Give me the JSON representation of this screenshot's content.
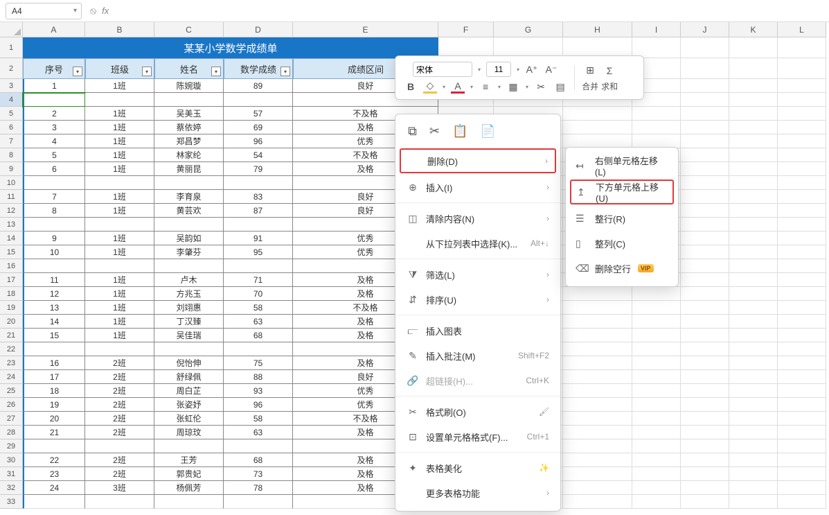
{
  "namebox": "A4",
  "fx": "fx",
  "cols": [
    "A",
    "B",
    "C",
    "D",
    "E",
    "F",
    "G",
    "H",
    "I",
    "J",
    "K",
    "L"
  ],
  "table": {
    "title": "某某小学数学成绩单",
    "headers": [
      "序号",
      "班级",
      "姓名",
      "数学成绩",
      "成绩区间"
    ]
  },
  "rows": [
    [
      "1",
      "1班",
      "陈婉璇",
      "89",
      "良好"
    ],
    [
      "",
      "",
      "",
      "",
      ""
    ],
    [
      "2",
      "1班",
      "吴美玉",
      "57",
      "不及格"
    ],
    [
      "3",
      "1班",
      "蔡依婷",
      "69",
      "及格"
    ],
    [
      "4",
      "1班",
      "郑昌梦",
      "96",
      "优秀"
    ],
    [
      "5",
      "1班",
      "林家纶",
      "54",
      "不及格"
    ],
    [
      "6",
      "1班",
      "黄丽昆",
      "79",
      "及格"
    ],
    [
      "",
      "",
      "",
      "",
      ""
    ],
    [
      "7",
      "1班",
      "李育泉",
      "83",
      "良好"
    ],
    [
      "8",
      "1班",
      "黄芸欢",
      "87",
      "良好"
    ],
    [
      "",
      "",
      "",
      "",
      ""
    ],
    [
      "9",
      "1班",
      "吴韵如",
      "91",
      "优秀"
    ],
    [
      "10",
      "1班",
      "李肇芬",
      "95",
      "优秀"
    ],
    [
      "",
      "",
      "",
      "",
      ""
    ],
    [
      "11",
      "1班",
      "卢木",
      "71",
      "及格"
    ],
    [
      "12",
      "1班",
      "方兆玉",
      "70",
      "及格"
    ],
    [
      "13",
      "1班",
      "刘翊惠",
      "58",
      "不及格"
    ],
    [
      "14",
      "1班",
      "丁汉臻",
      "63",
      "及格"
    ],
    [
      "15",
      "1班",
      "吴佳瑞",
      "68",
      "及格"
    ],
    [
      "",
      "",
      "",
      "",
      ""
    ],
    [
      "16",
      "2班",
      "倪怡伸",
      "75",
      "及格"
    ],
    [
      "17",
      "2班",
      "舒绿佩",
      "88",
      "良好"
    ],
    [
      "18",
      "2班",
      "周白芷",
      "93",
      "优秀"
    ],
    [
      "19",
      "2班",
      "张姿妤",
      "96",
      "优秀"
    ],
    [
      "20",
      "2班",
      "张虹伦",
      "58",
      "不及格"
    ],
    [
      "21",
      "2班",
      "周琼玟",
      "63",
      "及格"
    ],
    [
      "",
      "",
      "",
      "",
      ""
    ],
    [
      "22",
      "2班",
      "王芳",
      "68",
      "及格"
    ],
    [
      "23",
      "2班",
      "郭贵妃",
      "73",
      "及格"
    ],
    [
      "24",
      "3班",
      "杨佩芳",
      "78",
      "及格"
    ]
  ],
  "mini": {
    "font": "宋体",
    "size": "11",
    "merge": "合并",
    "sum": "求和"
  },
  "menu": {
    "delete": "删除(D)",
    "insert": "插入(I)",
    "clear": "清除内容(N)",
    "droplist": "从下拉列表中选择(K)...",
    "droplist_hint": "Alt+↓",
    "filter": "筛选(L)",
    "sort": "排序(U)",
    "chart": "插入图表",
    "comment": "插入批注(M)",
    "comment_hint": "Shift+F2",
    "hyperlink": "超链接(H)...",
    "hyperlink_hint": "Ctrl+K",
    "painter": "格式刷(O)",
    "cellfmt": "设置单元格格式(F)...",
    "cellfmt_hint": "Ctrl+1",
    "beautify": "表格美化",
    "more": "更多表格功能"
  },
  "submenu": {
    "shiftleft": "右侧单元格左移(L)",
    "shiftup": "下方单元格上移(U)",
    "entirerow": "整行(R)",
    "entirecol": "整列(C)",
    "delblank": "删除空行",
    "vip": "VIP"
  }
}
